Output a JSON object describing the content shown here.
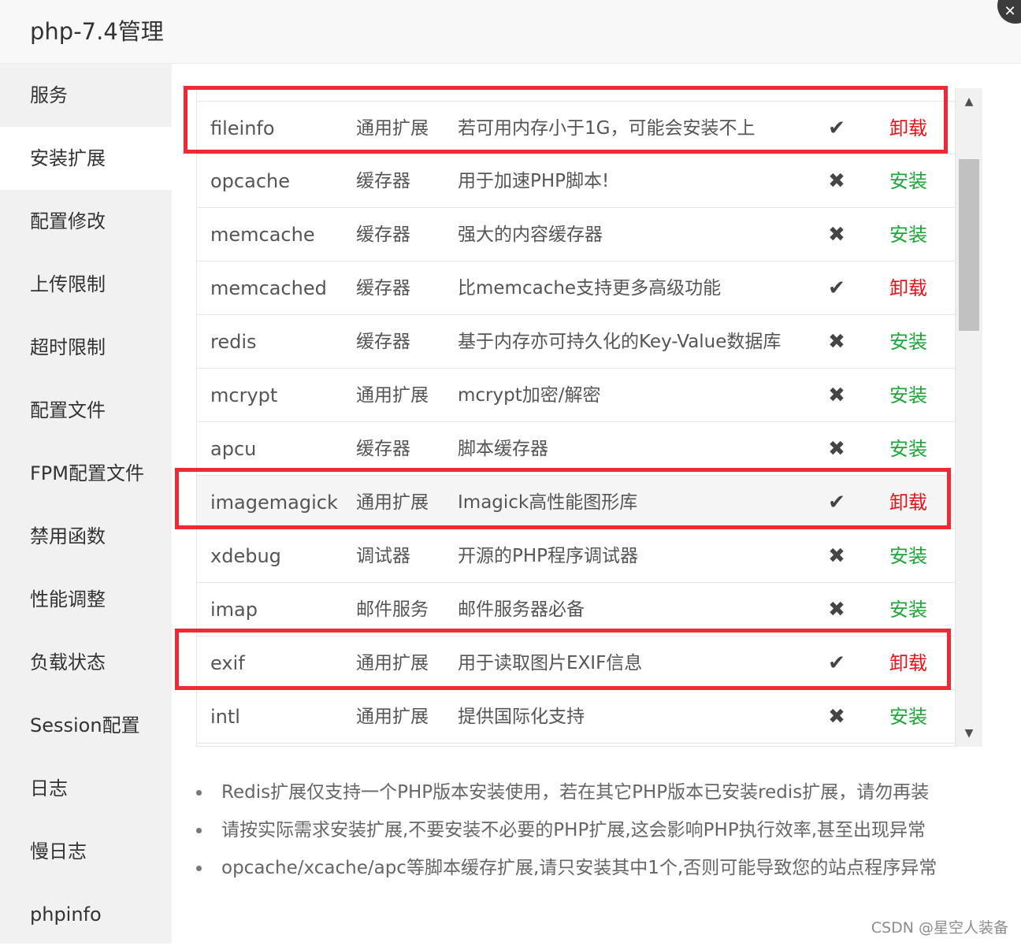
{
  "window": {
    "title": "php-7.4管理",
    "close_label": "✕"
  },
  "sidebar": {
    "active_index": 1,
    "items": [
      {
        "label": "服务"
      },
      {
        "label": "安装扩展"
      },
      {
        "label": "配置修改"
      },
      {
        "label": "上传限制"
      },
      {
        "label": "超时限制"
      },
      {
        "label": "配置文件"
      },
      {
        "label": "FPM配置文件"
      },
      {
        "label": "禁用函数"
      },
      {
        "label": "性能调整"
      },
      {
        "label": "负载状态"
      },
      {
        "label": "Session配置"
      },
      {
        "label": "日志"
      },
      {
        "label": "慢日志"
      },
      {
        "label": "phpinfo"
      }
    ]
  },
  "extensions": [
    {
      "name": "fileinfo",
      "type": "通用扩展",
      "desc": "若可用内存小于1G，可能会安装不上",
      "installed": true,
      "action": "卸载",
      "highlighted_box": true,
      "hover": false
    },
    {
      "name": "opcache",
      "type": "缓存器",
      "desc": "用于加速PHP脚本!",
      "installed": false,
      "action": "安装",
      "highlighted_box": false,
      "hover": false
    },
    {
      "name": "memcache",
      "type": "缓存器",
      "desc": "强大的内容缓存器",
      "installed": false,
      "action": "安装",
      "highlighted_box": false,
      "hover": false
    },
    {
      "name": "memcached",
      "type": "缓存器",
      "desc": "比memcache支持更多高级功能",
      "installed": true,
      "action": "卸载",
      "highlighted_box": false,
      "hover": false
    },
    {
      "name": "redis",
      "type": "缓存器",
      "desc": "基于内存亦可持久化的Key-Value数据库",
      "installed": false,
      "action": "安装",
      "highlighted_box": false,
      "hover": false
    },
    {
      "name": "mcrypt",
      "type": "通用扩展",
      "desc": "mcrypt加密/解密",
      "installed": false,
      "action": "安装",
      "highlighted_box": false,
      "hover": false
    },
    {
      "name": "apcu",
      "type": "缓存器",
      "desc": "脚本缓存器",
      "installed": false,
      "action": "安装",
      "highlighted_box": false,
      "hover": false
    },
    {
      "name": "imagemagick",
      "type": "通用扩展",
      "desc": "Imagick高性能图形库",
      "installed": true,
      "action": "卸载",
      "highlighted_box": true,
      "hover": true
    },
    {
      "name": "xdebug",
      "type": "调试器",
      "desc": "开源的PHP程序调试器",
      "installed": false,
      "action": "安装",
      "highlighted_box": false,
      "hover": false
    },
    {
      "name": "imap",
      "type": "邮件服务",
      "desc": "邮件服务器必备",
      "installed": false,
      "action": "安装",
      "highlighted_box": false,
      "hover": false
    },
    {
      "name": "exif",
      "type": "通用扩展",
      "desc": "用于读取图片EXIF信息",
      "installed": true,
      "action": "卸载",
      "highlighted_box": true,
      "hover": false
    },
    {
      "name": "intl",
      "type": "通用扩展",
      "desc": "提供国际化支持",
      "installed": false,
      "action": "安装",
      "highlighted_box": false,
      "hover": false
    }
  ],
  "status_icons": {
    "installed": "✔",
    "not_installed": "✖"
  },
  "scrollbar": {
    "up_arrow": "▲",
    "down_arrow": "▼"
  },
  "notes": [
    "Redis扩展仅支持一个PHP版本安装使用，若在其它PHP版本已安装redis扩展，请勿再装",
    "请按实际需求安装扩展,不要安装不必要的PHP扩展,这会影响PHP执行效率,甚至出现异常",
    "opcache/xcache/apc等脚本缓存扩展,请只安装其中1个,否则可能导致您的站点程序异常"
  ],
  "watermark": "CSDN @星空人装备",
  "colors": {
    "install": "#20a53a",
    "uninstall": "#e8131a",
    "annotation_box": "#ee2a34",
    "sidebar_bg": "#f1f1f1"
  }
}
